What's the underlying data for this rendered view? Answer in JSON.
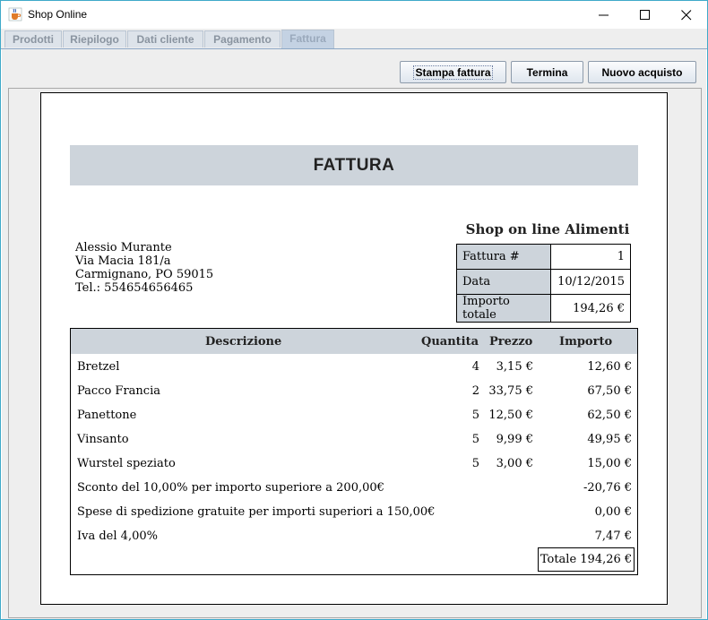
{
  "window": {
    "title": "Shop Online",
    "icon": "java-cup-icon"
  },
  "tabs": [
    {
      "label": "Prodotti",
      "active": false
    },
    {
      "label": "Riepilogo",
      "active": false
    },
    {
      "label": "Dati cliente",
      "active": false
    },
    {
      "label": "Pagamento",
      "active": false
    },
    {
      "label": "Fattura",
      "active": true
    }
  ],
  "toolbar": {
    "print_label": "Stampa fattura",
    "finish_label": "Termina",
    "new_purchase_label": "Nuovo acquisto"
  },
  "invoice": {
    "heading": "FATTURA",
    "shop_name": "Shop on line Alimenti",
    "customer": {
      "name": "Alessio Murante",
      "street": "Via Macia 181/a",
      "city": "Carmignano, PO 59015",
      "phone": "Tel.: 554654656465"
    },
    "info": [
      {
        "label": "Fattura #",
        "value": "1"
      },
      {
        "label": "Data",
        "value": "10/12/2015"
      },
      {
        "label": "Importo totale",
        "value": "194,26 €"
      }
    ],
    "columns": {
      "description": "Descrizione",
      "quantity": "Quantita",
      "price": "Prezzo",
      "amount": "Importo"
    },
    "items": [
      {
        "description": "Bretzel",
        "quantity": "4",
        "price": "3,15 €",
        "amount": "12,60 €"
      },
      {
        "description": "Pacco Francia",
        "quantity": "2",
        "price": "33,75 €",
        "amount": "67,50 €"
      },
      {
        "description": "Panettone",
        "quantity": "5",
        "price": "12,50 €",
        "amount": "62,50 €"
      },
      {
        "description": "Vinsanto",
        "quantity": "5",
        "price": "9,99 €",
        "amount": "49,95 €"
      },
      {
        "description": "Wurstel speziato",
        "quantity": "5",
        "price": "3,00 €",
        "amount": "15,00 €"
      }
    ],
    "adjustments": [
      {
        "description": "Sconto del 10,00% per importo superiore a 200,00€",
        "amount": "-20,76 €"
      },
      {
        "description": "Spese di spedizione gratuite per importi superiori a 150,00€",
        "amount": "0,00 €"
      },
      {
        "description": "Iva del 4,00%",
        "amount": "7,47 €"
      }
    ],
    "total": "Totale 194,26 €"
  }
}
